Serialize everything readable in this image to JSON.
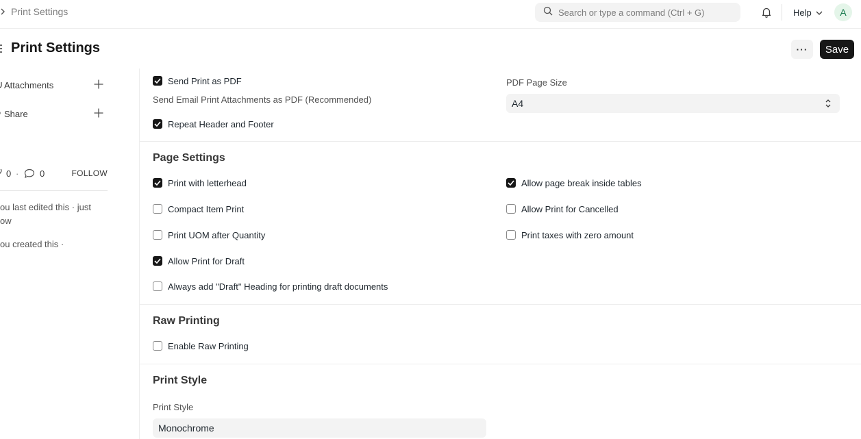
{
  "navbar": {
    "breadcrumb": "Print Settings",
    "search_placeholder": "Search or type a command (Ctrl + G)",
    "help_label": "Help",
    "avatar_initial": "A"
  },
  "page": {
    "title": "Print Settings",
    "more_label": "···",
    "save_label": "Save"
  },
  "sidebar": {
    "attachments_label": "Attachments",
    "share_label": "Share",
    "likes_count": "0",
    "comments_count": "0",
    "follow_label": "FOLLOW",
    "last_edited": "ou last edited this · just ow",
    "created": "ou created this ·"
  },
  "form": {
    "pdf": {
      "send_print_as_pdf": {
        "label": "Send Print as PDF",
        "checked": true
      },
      "send_print_as_pdf_desc": "Send Email Print Attachments as PDF (Recommended)",
      "repeat_header_footer": {
        "label": "Repeat Header and Footer",
        "checked": true
      },
      "pdf_page_size_label": "PDF Page Size",
      "pdf_page_size_value": "A4"
    },
    "page_settings": {
      "title": "Page Settings",
      "print_with_letterhead": {
        "label": "Print with letterhead",
        "checked": true
      },
      "compact_item_print": {
        "label": "Compact Item Print",
        "checked": false
      },
      "print_uom_after_quantity": {
        "label": "Print UOM after Quantity",
        "checked": false
      },
      "allow_print_for_draft": {
        "label": "Allow Print for Draft",
        "checked": true
      },
      "always_add_draft_heading": {
        "label": "Always add \"Draft\" Heading for printing draft documents",
        "checked": false
      },
      "allow_page_break_inside_tables": {
        "label": "Allow page break inside tables",
        "checked": true
      },
      "allow_print_for_cancelled": {
        "label": "Allow Print for Cancelled",
        "checked": false
      },
      "print_taxes_with_zero_amount": {
        "label": "Print taxes with zero amount",
        "checked": false
      }
    },
    "raw_printing": {
      "title": "Raw Printing",
      "enable_raw_printing": {
        "label": "Enable Raw Printing",
        "checked": false
      }
    },
    "print_style": {
      "title": "Print Style",
      "label": "Print Style",
      "value": "Monochrome"
    }
  },
  "icons": {
    "search": "search-icon",
    "bell": "bell-icon",
    "chevron_down": "chevron-down-icon",
    "plus": "plus-icon",
    "paperclip": "paperclip-icon",
    "share": "share-icon",
    "heart": "heart-icon",
    "comment": "comment-icon",
    "check": "check-icon",
    "updown": "select-arrows-icon"
  }
}
